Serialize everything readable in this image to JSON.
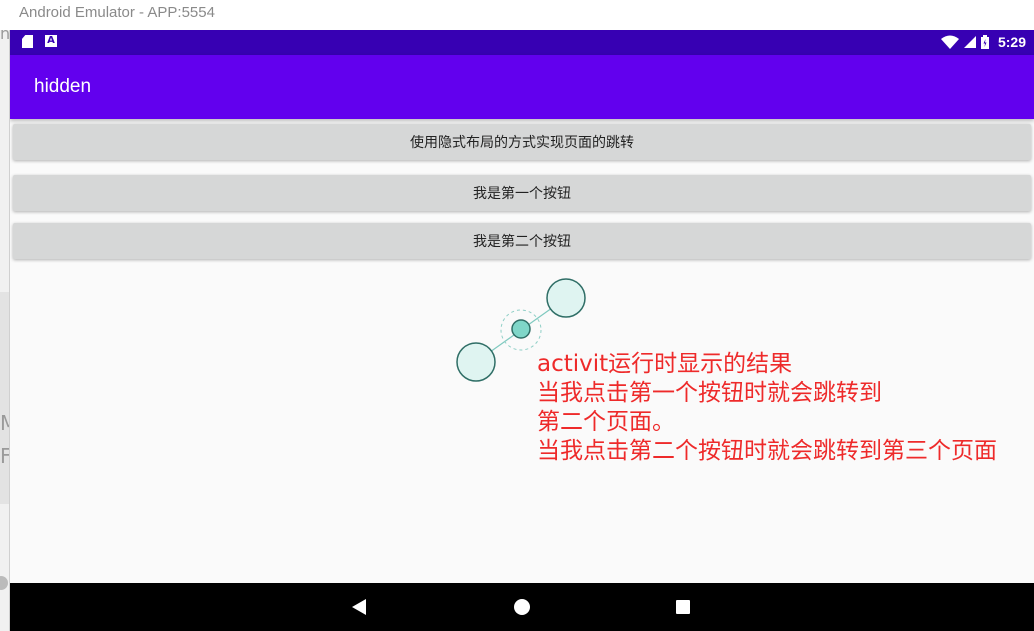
{
  "window": {
    "title": "Android Emulator - APP:5554"
  },
  "status_bar": {
    "time": "5:29",
    "background": "#3700b3",
    "left_icons": [
      "sd-card-icon",
      "a-notification-icon"
    ],
    "right_icons": [
      "wifi-icon",
      "signal-icon",
      "battery-icon"
    ]
  },
  "app_bar": {
    "title": "hidden",
    "background": "#6200ee"
  },
  "buttons": [
    {
      "label": "使用隐式布局的方式实现页面的跳转"
    },
    {
      "label": "我是第一个按钮"
    },
    {
      "label": "我是第二个按钮"
    }
  ],
  "annotation": {
    "color": "#ee2a2a",
    "lines": [
      "activit运行时显示的结果",
      "当我点击第一个按钮时就会跳转到",
      "第二个页面。",
      "当我点击第二个按钮时就会跳转到第三个页面"
    ]
  },
  "nav_bar": {
    "icons": [
      "back-icon",
      "home-icon",
      "recents-icon"
    ]
  },
  "left_strip": {
    "fragments": [
      "h",
      "M",
      "F"
    ]
  }
}
